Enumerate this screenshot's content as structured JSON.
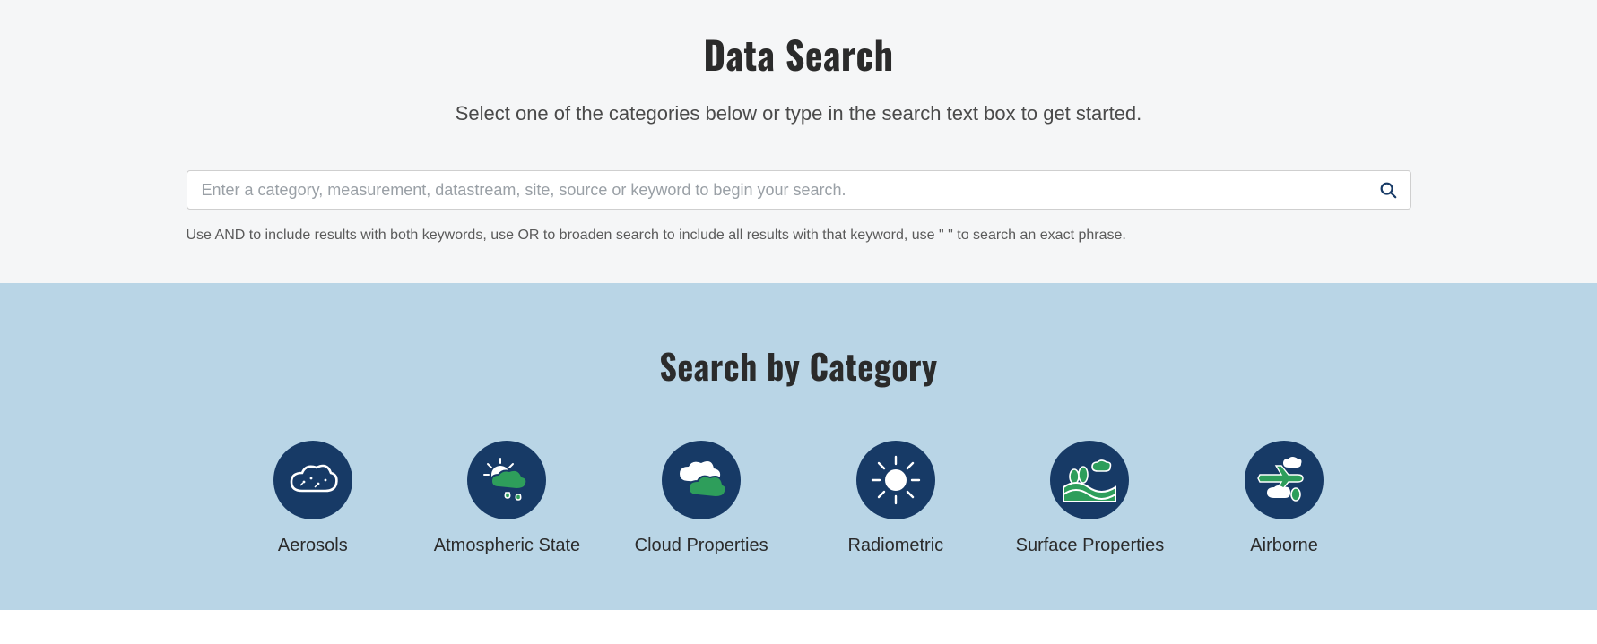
{
  "header": {
    "title": "Data Search",
    "subtitle": "Select one of the categories below or type in the search text box to get started."
  },
  "search": {
    "placeholder": "Enter a category, measurement, datastream, site, source or keyword to begin your search.",
    "value": "",
    "hint": "Use AND to include results with both keywords, use OR to broaden search to include all results with that keyword, use \" \" to search an exact phrase."
  },
  "categories": {
    "title": "Search by Category",
    "items": [
      {
        "label": "Aerosols",
        "icon": "aerosols-icon"
      },
      {
        "label": "Atmospheric State",
        "icon": "atmospheric-state-icon"
      },
      {
        "label": "Cloud Properties",
        "icon": "cloud-properties-icon"
      },
      {
        "label": "Radiometric",
        "icon": "radiometric-icon"
      },
      {
        "label": "Surface Properties",
        "icon": "surface-properties-icon"
      },
      {
        "label": "Airborne",
        "icon": "airborne-icon"
      }
    ]
  },
  "colors": {
    "navy": "#173a66",
    "green": "#2e9e5b",
    "bg_bottom": "#b9d5e6"
  }
}
